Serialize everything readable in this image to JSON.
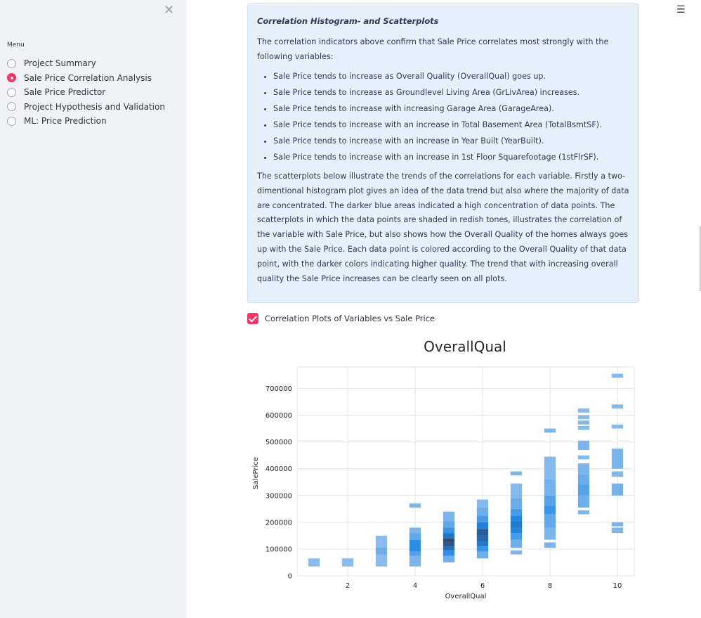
{
  "sidebar": {
    "close_icon": "close-x-icon",
    "menu_label": "Menu",
    "items": [
      {
        "label": "Project Summary",
        "selected": false
      },
      {
        "label": "Sale Price Correlation Analysis",
        "selected": true
      },
      {
        "label": "Sale Price Predictor",
        "selected": false
      },
      {
        "label": "Project Hypothesis and Validation",
        "selected": false
      },
      {
        "label": "ML: Price Prediction",
        "selected": false
      }
    ]
  },
  "header": {
    "menu_icon": "hamburger-menu-icon"
  },
  "info": {
    "title": "Correlation Histogram- and Scatterplots",
    "intro": "The correlation indicators above confirm that Sale Price correlates most strongly with the following variables:",
    "bullets": [
      "Sale Price tends to increase as Overall Quality (OverallQual) goes up.",
      "Sale Price tends to increase as Groundlevel Living Area (GrLivArea) increases.",
      "Sale Price tends to increase with increasing Garage Area (GarageArea).",
      "Sale Price tends to increase with an increase in Total Basement Area (TotalBsmtSF).",
      "Sale Price tends to increase with an increase in Year Built (YearBuilt).",
      "Sale Price tends to increase with an increase in 1st Floor Squarefootage (1stFlrSF)."
    ],
    "description": "The scatterplots below illustrate the trends of the correlations for each variable. Firstly a two-dimentional histogram plot gives an idea of the data trend but also where the majority of data are concentrated. The darker blue areas indicated a high concentration of data points. The scatterplots in which the data points are shaded in redish tones, illustrates the correlation of the variable with Sale Price, but also shows how the Overall Quality of the homes always goes up with the Sale Price. Each data point is colored according to the Overall Quality of that data point, with the darker colors indicating higher quality. The trend that with increasing overall quality the Sale Price increases can be clearly seen on all plots."
  },
  "checkbox": {
    "label": "Correlation Plots of Variables vs Sale Price",
    "checked": true
  },
  "colors": {
    "accent": "#f63366",
    "info_bg": "#e5f0fb",
    "sidebar_bg": "#f0f2f6",
    "hist_light": "#a6c8ee",
    "hist_dark": "#2e4b73"
  },
  "chart_data": {
    "type": "heatmap",
    "title": "OverallQual",
    "xlabel": "OverallQual",
    "ylabel": "SalePrice",
    "xlim": [
      0.5,
      10.5
    ],
    "ylim": [
      0,
      780000
    ],
    "x_ticks": [
      "2",
      "4",
      "6",
      "8",
      "10"
    ],
    "y_ticks": [
      "0",
      "100000",
      "200000",
      "300000",
      "400000",
      "500000",
      "600000",
      "700000"
    ],
    "grid": true,
    "bins": [
      {
        "x": 1,
        "y0": 35000,
        "y1": 65000,
        "density": 0.1
      },
      {
        "x": 2,
        "y0": 35000,
        "y1": 65000,
        "density": 0.1
      },
      {
        "x": 3,
        "y0": 35000,
        "y1": 80000,
        "density": 0.1
      },
      {
        "x": 3,
        "y0": 80000,
        "y1": 105000,
        "density": 0.2
      },
      {
        "x": 3,
        "y0": 105000,
        "y1": 150000,
        "density": 0.1
      },
      {
        "x": 4,
        "y0": 35000,
        "y1": 75000,
        "density": 0.15
      },
      {
        "x": 4,
        "y0": 75000,
        "y1": 90000,
        "density": 0.3
      },
      {
        "x": 4,
        "y0": 90000,
        "y1": 135000,
        "density": 0.45
      },
      {
        "x": 4,
        "y0": 135000,
        "y1": 160000,
        "density": 0.25
      },
      {
        "x": 4,
        "y0": 160000,
        "y1": 180000,
        "density": 0.15
      },
      {
        "x": 4,
        "y0": 255000,
        "y1": 270000,
        "density": 0.15
      },
      {
        "x": 5,
        "y0": 50000,
        "y1": 75000,
        "density": 0.2
      },
      {
        "x": 5,
        "y0": 75000,
        "y1": 95000,
        "density": 0.45
      },
      {
        "x": 5,
        "y0": 95000,
        "y1": 110000,
        "density": 0.7
      },
      {
        "x": 5,
        "y0": 110000,
        "y1": 125000,
        "density": 0.9
      },
      {
        "x": 5,
        "y0": 125000,
        "y1": 140000,
        "density": 1.0
      },
      {
        "x": 5,
        "y0": 140000,
        "y1": 160000,
        "density": 0.65
      },
      {
        "x": 5,
        "y0": 160000,
        "y1": 180000,
        "density": 0.4
      },
      {
        "x": 5,
        "y0": 180000,
        "y1": 205000,
        "density": 0.25
      },
      {
        "x": 5,
        "y0": 205000,
        "y1": 240000,
        "density": 0.15
      },
      {
        "x": 6,
        "y0": 65000,
        "y1": 90000,
        "density": 0.2
      },
      {
        "x": 6,
        "y0": 90000,
        "y1": 110000,
        "density": 0.4
      },
      {
        "x": 6,
        "y0": 110000,
        "y1": 130000,
        "density": 0.6
      },
      {
        "x": 6,
        "y0": 130000,
        "y1": 150000,
        "density": 0.75
      },
      {
        "x": 6,
        "y0": 150000,
        "y1": 175000,
        "density": 0.85
      },
      {
        "x": 6,
        "y0": 175000,
        "y1": 200000,
        "density": 0.55
      },
      {
        "x": 6,
        "y0": 200000,
        "y1": 225000,
        "density": 0.35
      },
      {
        "x": 6,
        "y0": 225000,
        "y1": 255000,
        "density": 0.2
      },
      {
        "x": 6,
        "y0": 255000,
        "y1": 285000,
        "density": 0.12
      },
      {
        "x": 7,
        "y0": 80000,
        "y1": 95000,
        "density": 0.15
      },
      {
        "x": 7,
        "y0": 105000,
        "y1": 135000,
        "density": 0.2
      },
      {
        "x": 7,
        "y0": 135000,
        "y1": 160000,
        "density": 0.35
      },
      {
        "x": 7,
        "y0": 160000,
        "y1": 180000,
        "density": 0.5
      },
      {
        "x": 7,
        "y0": 180000,
        "y1": 205000,
        "density": 0.6
      },
      {
        "x": 7,
        "y0": 205000,
        "y1": 225000,
        "density": 0.5
      },
      {
        "x": 7,
        "y0": 225000,
        "y1": 250000,
        "density": 0.35
      },
      {
        "x": 7,
        "y0": 250000,
        "y1": 290000,
        "density": 0.22
      },
      {
        "x": 7,
        "y0": 290000,
        "y1": 345000,
        "density": 0.12
      },
      {
        "x": 7,
        "y0": 375000,
        "y1": 390000,
        "density": 0.15
      },
      {
        "x": 8,
        "y0": 105000,
        "y1": 125000,
        "density": 0.15
      },
      {
        "x": 8,
        "y0": 135000,
        "y1": 180000,
        "density": 0.15
      },
      {
        "x": 8,
        "y0": 180000,
        "y1": 230000,
        "density": 0.25
      },
      {
        "x": 8,
        "y0": 230000,
        "y1": 260000,
        "density": 0.4
      },
      {
        "x": 8,
        "y0": 260000,
        "y1": 300000,
        "density": 0.3
      },
      {
        "x": 8,
        "y0": 300000,
        "y1": 360000,
        "density": 0.18
      },
      {
        "x": 8,
        "y0": 360000,
        "y1": 445000,
        "density": 0.12
      },
      {
        "x": 8,
        "y0": 535000,
        "y1": 550000,
        "density": 0.15
      },
      {
        "x": 9,
        "y0": 230000,
        "y1": 245000,
        "density": 0.15
      },
      {
        "x": 9,
        "y0": 255000,
        "y1": 300000,
        "density": 0.2
      },
      {
        "x": 9,
        "y0": 300000,
        "y1": 340000,
        "density": 0.3
      },
      {
        "x": 9,
        "y0": 340000,
        "y1": 380000,
        "density": 0.22
      },
      {
        "x": 9,
        "y0": 380000,
        "y1": 420000,
        "density": 0.15
      },
      {
        "x": 9,
        "y0": 435000,
        "y1": 450000,
        "density": 0.12
      },
      {
        "x": 9,
        "y0": 470000,
        "y1": 505000,
        "density": 0.15
      },
      {
        "x": 9,
        "y0": 545000,
        "y1": 560000,
        "density": 0.12
      },
      {
        "x": 9,
        "y0": 565000,
        "y1": 580000,
        "density": 0.12
      },
      {
        "x": 9,
        "y0": 585000,
        "y1": 600000,
        "density": 0.12
      },
      {
        "x": 9,
        "y0": 610000,
        "y1": 625000,
        "density": 0.12
      },
      {
        "x": 10,
        "y0": 160000,
        "y1": 180000,
        "density": 0.15
      },
      {
        "x": 10,
        "y0": 185000,
        "y1": 200000,
        "density": 0.15
      },
      {
        "x": 10,
        "y0": 300000,
        "y1": 345000,
        "density": 0.18
      },
      {
        "x": 10,
        "y0": 370000,
        "y1": 390000,
        "density": 0.12
      },
      {
        "x": 10,
        "y0": 400000,
        "y1": 475000,
        "density": 0.15
      },
      {
        "x": 10,
        "y0": 550000,
        "y1": 565000,
        "density": 0.12
      },
      {
        "x": 10,
        "y0": 625000,
        "y1": 640000,
        "density": 0.12
      },
      {
        "x": 10,
        "y0": 740000,
        "y1": 755000,
        "density": 0.12
      }
    ]
  }
}
